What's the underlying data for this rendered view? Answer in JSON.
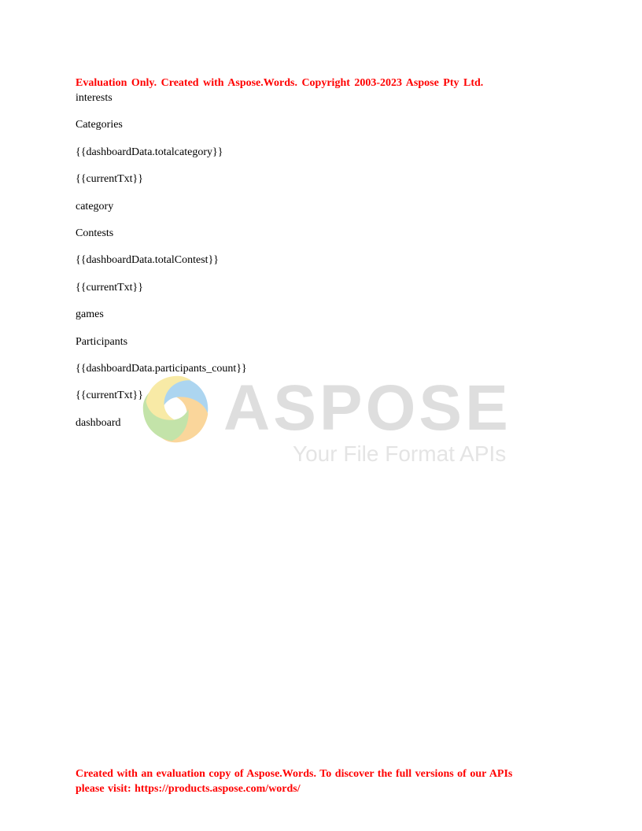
{
  "evaluation_header": "Evaluation Only. Created with Aspose.Words. Copyright 2003-2023 Aspose Pty Ltd.",
  "document": {
    "lines": [
      "interests",
      "Categories",
      "{{dashboardData.totalcategory}}",
      "{{currentTxt}}",
      "category",
      "Contests",
      "{{dashboardData.totalContest}}",
      "{{currentTxt}}",
      "games",
      "Participants",
      "{{dashboardData.participants_count}}",
      "{{currentTxt}}",
      "dashboard"
    ]
  },
  "watermark": {
    "wordmark": "ASPOSE",
    "tagline": "Your File Format APIs",
    "icon": "aspose-swirl-logo-icon"
  },
  "evaluation_footer": {
    "line1": "Created with an evaluation copy of Aspose.Words. To discover the full versions of our APIs",
    "line2": "please visit: https://products.aspose.com/words/"
  },
  "colors": {
    "notice_red": "#ff0000",
    "watermark_gray": "#b8b8b8",
    "logo_blue": "#4aa3df",
    "logo_orange": "#f5a623"
  }
}
